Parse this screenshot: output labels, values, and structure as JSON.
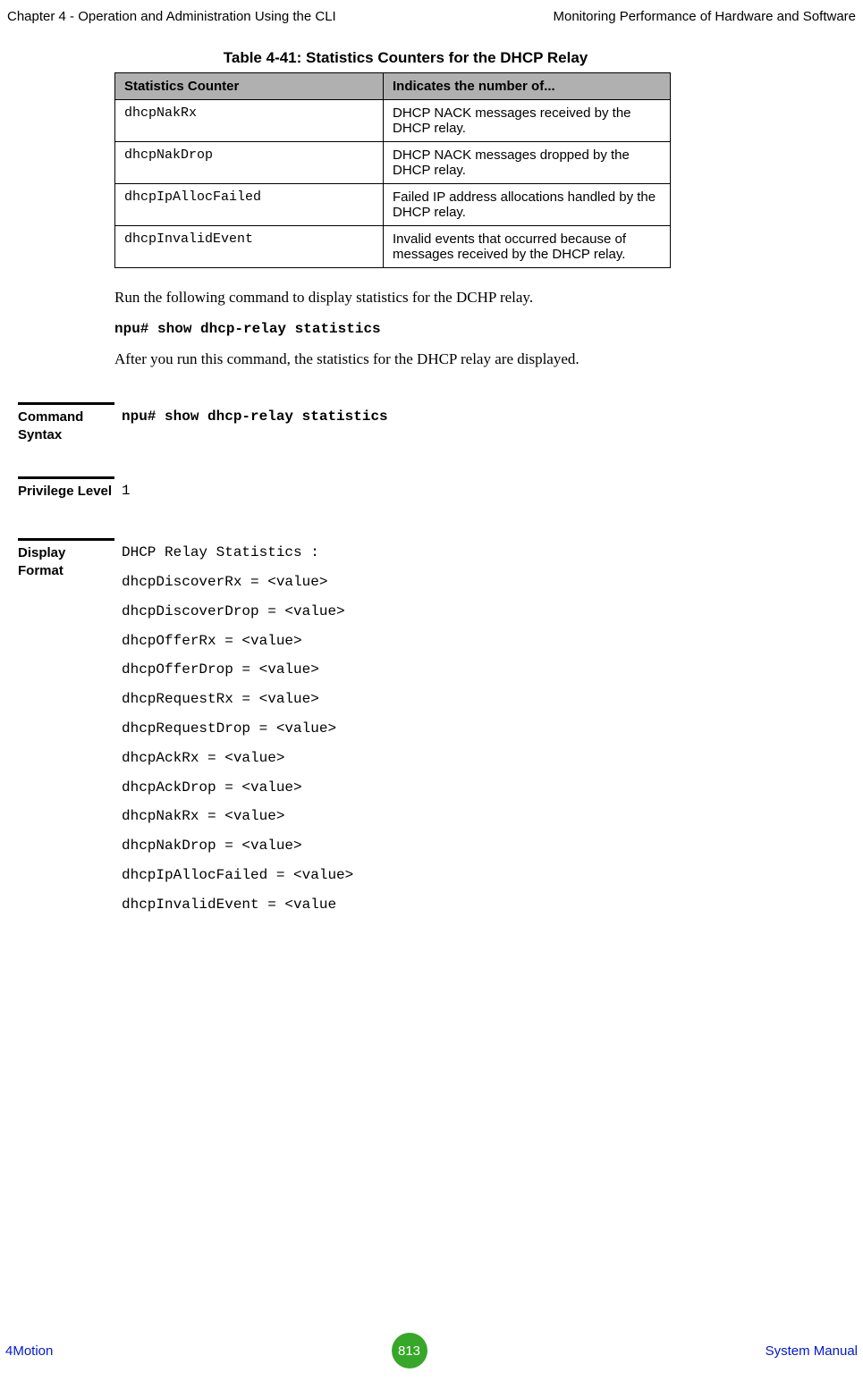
{
  "header": {
    "left": "Chapter 4 - Operation and Administration Using the CLI",
    "right": "Monitoring Performance of Hardware and Software"
  },
  "table": {
    "caption": "Table 4-41: Statistics Counters for the DHCP Relay",
    "col1": "Statistics Counter",
    "col2": "Indicates the number of...",
    "rows": [
      {
        "c": "dhcpNakRx",
        "d": "DHCP NACK messages received by the DHCP relay."
      },
      {
        "c": "dhcpNakDrop",
        "d": "DHCP NACK messages dropped by the DHCP relay."
      },
      {
        "c": "dhcpIpAllocFailed",
        "d": "Failed IP address allocations handled by the DHCP relay."
      },
      {
        "c": "dhcpInvalidEvent",
        "d": "Invalid events that occurred because of messages received by the DHCP relay."
      }
    ]
  },
  "para1": "Run the following command to display statistics for the DCHP relay.",
  "cmd1": "npu# show dhcp-relay statistics",
  "para2": "After you run this command, the statistics for the DHCP relay are displayed.",
  "sections": {
    "syntax": {
      "label": "Command Syntax",
      "value": "npu# show dhcp-relay statistics"
    },
    "privilege": {
      "label": "Privilege Level",
      "value": "1"
    },
    "display": {
      "label": "Display Format",
      "lines": [
        "DHCP Relay Statistics :",
        "dhcpDiscoverRx = <value>",
        "dhcpDiscoverDrop = <value>",
        "dhcpOfferRx = <value>",
        "dhcpOfferDrop = <value>",
        "dhcpRequestRx = <value>",
        "dhcpRequestDrop = <value>",
        "dhcpAckRx = <value>",
        "dhcpAckDrop = <value>",
        "dhcpNakRx = <value>",
        "dhcpNakDrop = <value>",
        "dhcpIpAllocFailed = <value>",
        "dhcpInvalidEvent = <value"
      ]
    }
  },
  "footer": {
    "left": "4Motion",
    "page": "813",
    "right": "System Manual"
  }
}
